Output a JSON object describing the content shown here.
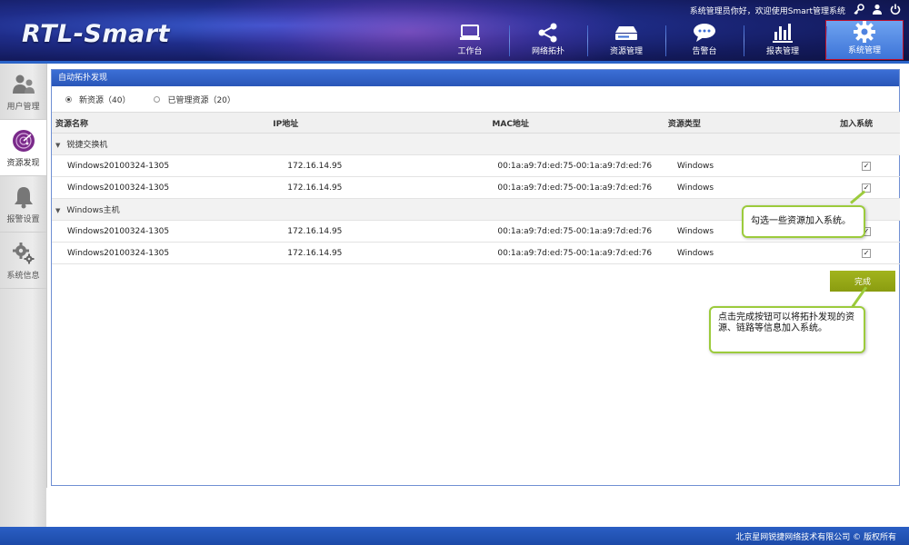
{
  "header": {
    "logo": "RTL-Smart",
    "welcome": "系统管理员你好，欢迎使用Smart管理系统",
    "top_icons": [
      "key-icon",
      "user-icon",
      "power-icon"
    ],
    "nav": [
      {
        "label": "工作台",
        "icon": "monitor-icon"
      },
      {
        "label": "网络拓扑",
        "icon": "share-icon"
      },
      {
        "label": "资源管理",
        "icon": "drive-icon"
      },
      {
        "label": "告警台",
        "icon": "chat-bubble-icon"
      },
      {
        "label": "报表管理",
        "icon": "bar-chart-icon"
      },
      {
        "label": "系统管理",
        "icon": "gear-icon"
      }
    ]
  },
  "sidebar": {
    "items": [
      {
        "label": "用户管理",
        "icon": "users-icon"
      },
      {
        "label": "资源发现",
        "icon": "radar-icon"
      },
      {
        "label": "报警设置",
        "icon": "bell-icon"
      },
      {
        "label": "系统信息",
        "icon": "gears-icon"
      }
    ]
  },
  "panel": {
    "title": "自动拓扑发现",
    "radio_new": "新资源（40）",
    "radio_managed": "已管理资源（20）",
    "columns": [
      "资源名称",
      "IP地址",
      "MAC地址",
      "资源类型",
      "加入系统"
    ],
    "groups": [
      {
        "name": "锐捷交换机",
        "rows": [
          {
            "name": "Windows20100324-1305",
            "ip": "172.16.14.95",
            "mac": "00:1a:a9:7d:ed:75-00:1a:a9:7d:ed:76",
            "type": "Windows",
            "checked": true
          },
          {
            "name": "Windows20100324-1305",
            "ip": "172.16.14.95",
            "mac": "00:1a:a9:7d:ed:75-00:1a:a9:7d:ed:76",
            "type": "Windows",
            "checked": true
          }
        ]
      },
      {
        "name": "Windows主机",
        "rows": [
          {
            "name": "Windows20100324-1305",
            "ip": "172.16.14.95",
            "mac": "00:1a:a9:7d:ed:75-00:1a:a9:7d:ed:76",
            "type": "Windows",
            "checked": true
          },
          {
            "name": "Windows20100324-1305",
            "ip": "172.16.14.95",
            "mac": "00:1a:a9:7d:ed:75-00:1a:a9:7d:ed:76",
            "type": "Windows",
            "checked": true
          }
        ]
      }
    ],
    "done_label": "完成"
  },
  "tips": {
    "select": "勾选一些资源加入系统。",
    "done": "点击完成按钮可以将拓扑发现的资源、链路等信息加入系统。"
  },
  "footer": {
    "copyright": "北京星网锐捷网络技术有限公司 © 版权所有"
  },
  "colors": {
    "header_dark": "#131a5c",
    "accent_blue": "#2a56b8",
    "done_green": "#8a9c10",
    "tip_border": "#9ccb3c",
    "active_outline": "#c0102a"
  }
}
